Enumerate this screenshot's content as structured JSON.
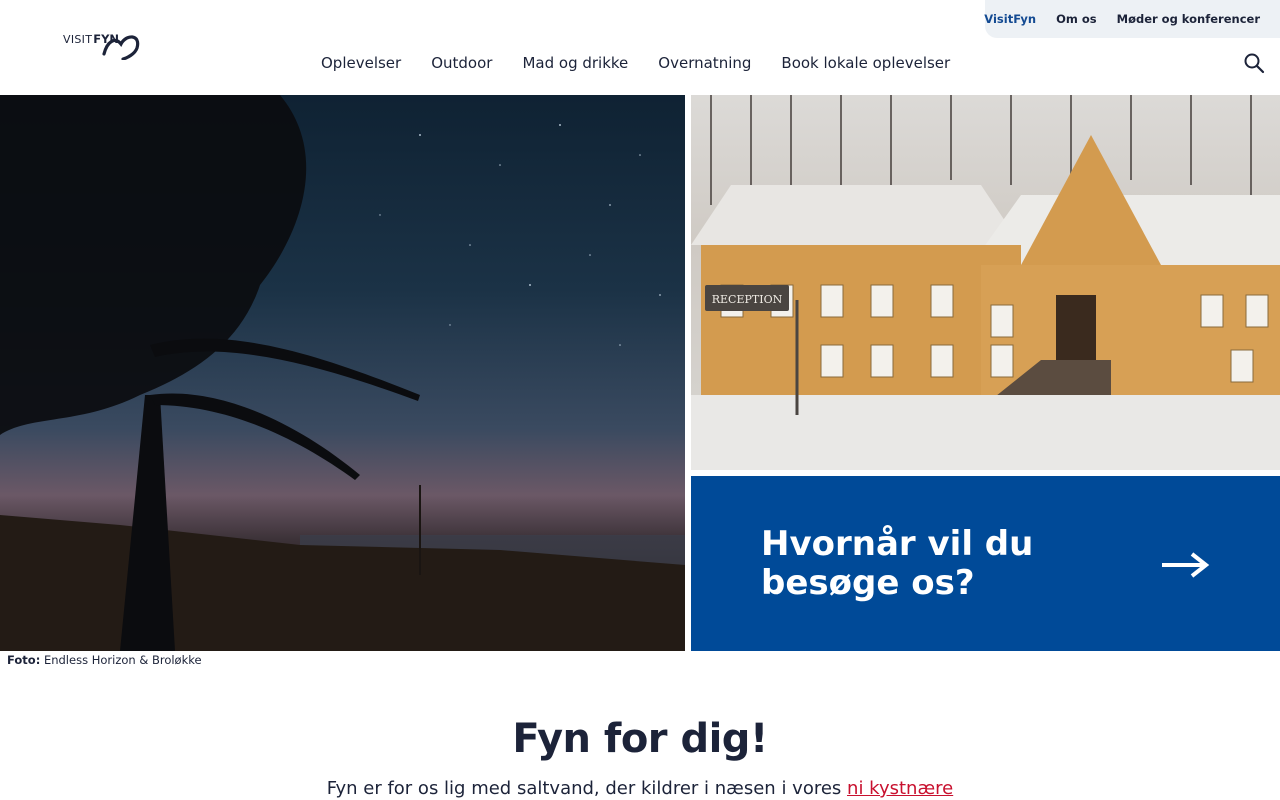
{
  "utility_nav": {
    "items": [
      "VisitFyn",
      "Om os",
      "Møder og konferencer"
    ]
  },
  "logo": {
    "visit": "VISIT",
    "fyn": "FYN"
  },
  "main_nav": {
    "items": [
      "Oplevelser",
      "Outdoor",
      "Mad og drikke",
      "Overnatning",
      "Book lokale oplevelser"
    ]
  },
  "icons": {
    "search": "search-icon",
    "arrow": "arrow-right-icon",
    "logo_heart": "heart-icon"
  },
  "hero": {
    "reception_sign": "RECEPTION",
    "cta_title": "Hvornår vil du besøge os?"
  },
  "credit": {
    "label": "Foto:",
    "text": "Endless Horizon & Broløkke"
  },
  "intro": {
    "title": "Fyn for dig!",
    "text": "Fyn er for os lig med saltvand, der kildrer i næsen i vores",
    "link": "ni kystnære"
  },
  "colors": {
    "brand_blue": "#004a98",
    "navy": "#1c2339",
    "accent_red": "#c8102e"
  }
}
